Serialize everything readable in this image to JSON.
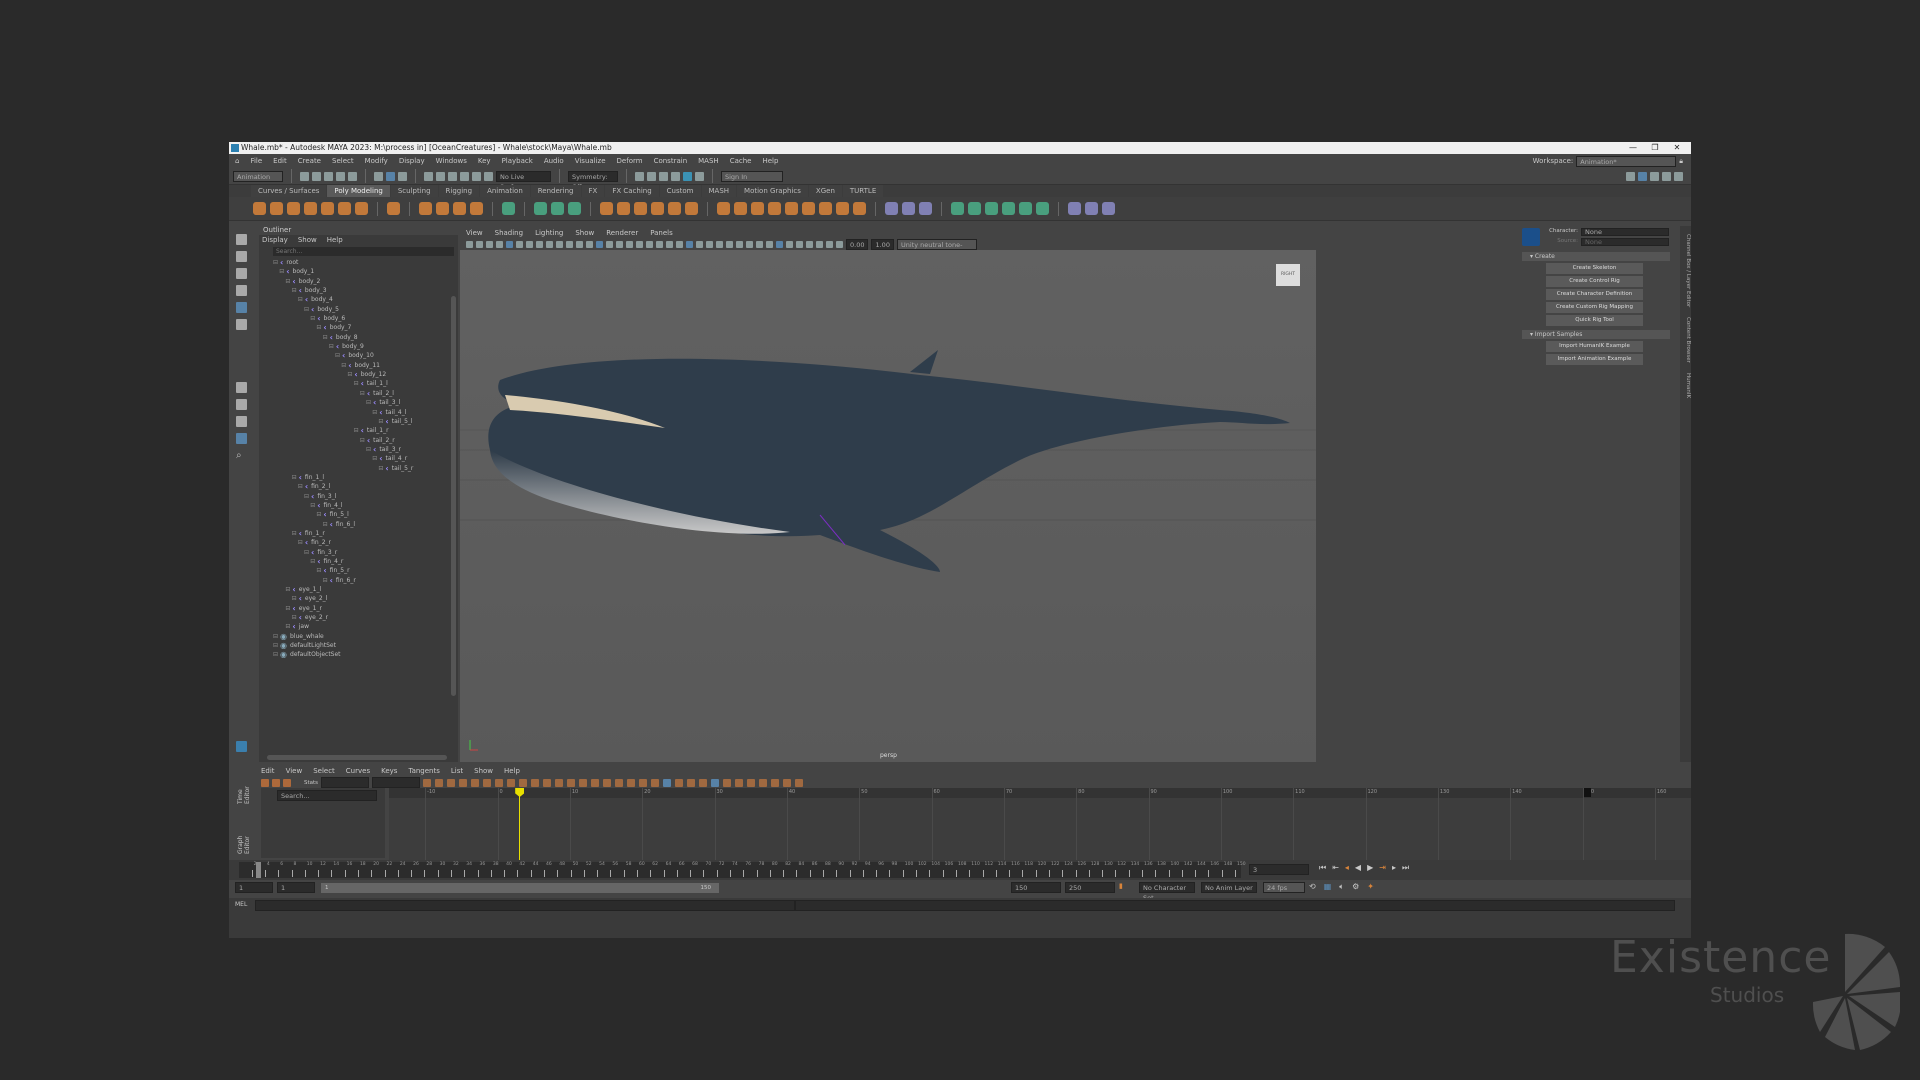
{
  "window": {
    "title": "Whale.mb* - Autodesk MAYA 2023: M:\\process in] [OceanCreatures] - Whale\\stock\\Maya\\Whale.mb",
    "min": "—",
    "max": "❐",
    "close": "✕"
  },
  "menu": [
    "File",
    "Edit",
    "Create",
    "Select",
    "Modify",
    "Display",
    "Windows",
    "Key",
    "Playback",
    "Audio",
    "Visualize",
    "Deform",
    "Constrain",
    "MASH",
    "Cache",
    "Help"
  ],
  "status": {
    "menuset": "Animation",
    "live_surface": "No Live Surface",
    "symmetry": "Symmetry: Off",
    "sign_in": "Sign In",
    "workspace_label": "Workspace:",
    "workspace_value": "Animation*"
  },
  "shelf_tabs": [
    "Curves / Surfaces",
    "Poly Modeling",
    "Sculpting",
    "Rigging",
    "Animation",
    "Rendering",
    "FX",
    "FX Caching",
    "Custom",
    "MASH",
    "Motion Graphics",
    "XGen",
    "TURTLE"
  ],
  "shelf_active": 1,
  "shelf_colors": {
    "poly": "#d9843a",
    "uv": "#4bb08a",
    "rig": "#8c8cc8"
  },
  "outliner": {
    "title": "Outliner",
    "menu": [
      "Display",
      "Show",
      "Help"
    ],
    "search_placeholder": "Search...",
    "items": [
      {
        "label": "root",
        "d": 0
      },
      {
        "label": "body_1",
        "d": 1
      },
      {
        "label": "body_2",
        "d": 2
      },
      {
        "label": "body_3",
        "d": 3
      },
      {
        "label": "body_4",
        "d": 4
      },
      {
        "label": "body_5",
        "d": 5
      },
      {
        "label": "body_6",
        "d": 6
      },
      {
        "label": "body_7",
        "d": 7
      },
      {
        "label": "body_8",
        "d": 8
      },
      {
        "label": "body_9",
        "d": 9
      },
      {
        "label": "body_10",
        "d": 10
      },
      {
        "label": "body_11",
        "d": 11
      },
      {
        "label": "body_12",
        "d": 12
      },
      {
        "label": "tail_1_l",
        "d": 13
      },
      {
        "label": "tail_2_l",
        "d": 14
      },
      {
        "label": "tail_3_l",
        "d": 15
      },
      {
        "label": "tail_4_l",
        "d": 16
      },
      {
        "label": "tail_5_l",
        "d": 17
      },
      {
        "label": "tail_1_r",
        "d": 13
      },
      {
        "label": "tail_2_r",
        "d": 14
      },
      {
        "label": "tail_3_r",
        "d": 15
      },
      {
        "label": "tail_4_r",
        "d": 16
      },
      {
        "label": "tail_5_r",
        "d": 17
      },
      {
        "label": "fin_1_l",
        "d": 3
      },
      {
        "label": "fin_2_l",
        "d": 4
      },
      {
        "label": "fin_3_l",
        "d": 5
      },
      {
        "label": "fin_4_l",
        "d": 6
      },
      {
        "label": "fin_5_l",
        "d": 7
      },
      {
        "label": "fin_6_l",
        "d": 8
      },
      {
        "label": "fin_1_r",
        "d": 3
      },
      {
        "label": "fin_2_r",
        "d": 4
      },
      {
        "label": "fin_3_r",
        "d": 5
      },
      {
        "label": "fin_4_r",
        "d": 6
      },
      {
        "label": "fin_5_r",
        "d": 7
      },
      {
        "label": "fin_6_r",
        "d": 8
      },
      {
        "label": "eye_1_l",
        "d": 2
      },
      {
        "label": "eye_2_l",
        "d": 3
      },
      {
        "label": "eye_1_r",
        "d": 2
      },
      {
        "label": "eye_2_r",
        "d": 3
      },
      {
        "label": "jaw",
        "d": 2
      },
      {
        "label": "blue_whale",
        "d": 0,
        "type": "mesh"
      },
      {
        "label": "defaultLightSet",
        "d": 0,
        "type": "set"
      },
      {
        "label": "defaultObjectSet",
        "d": 0,
        "type": "set"
      }
    ]
  },
  "viewport": {
    "menu": [
      "View",
      "Shading",
      "Lighting",
      "Show",
      "Renderer",
      "Panels"
    ],
    "exposure": "0.00",
    "gamma": "1.00",
    "color_space": "Unity neutral tone-map (sRGB)",
    "camera": "persp",
    "viewcube": "RIGHT"
  },
  "hik": {
    "character_label": "Character:",
    "character_value": "None",
    "source_label": "Source:",
    "source_value": "None",
    "create_header": "Create",
    "create_buttons": [
      "Create Skeleton",
      "Create Control Rig",
      "Create Character Definition",
      "Create Custom Rig Mapping",
      "Quick Rig Tool"
    ],
    "import_header": "Import Samples",
    "import_buttons": [
      "Import HumanIK Example",
      "Import Animation Example"
    ]
  },
  "side_tabs": [
    "Channel Box / Layer Editor",
    "Content Browser",
    "HumanIK"
  ],
  "graph": {
    "tabs": [
      "Graph Editor",
      "Time Editor"
    ],
    "menu": [
      "Edit",
      "View",
      "Select",
      "Curves",
      "Keys",
      "Tangents",
      "List",
      "Show",
      "Help"
    ],
    "stats_label": "Stats",
    "search_placeholder": "Search...",
    "ruler": [
      -10,
      0,
      10,
      20,
      30,
      40,
      50,
      60,
      70,
      80,
      90,
      100,
      110,
      120,
      130,
      140,
      150,
      160
    ],
    "current_frame": 3,
    "range_end_marker": 150,
    "view_min": -15,
    "view_max": 165
  },
  "timeline": {
    "start": 1,
    "end": 150,
    "current": 3,
    "tick_step": 2,
    "current_field": "3"
  },
  "range": {
    "start": "1",
    "anim_start": "1",
    "slider_start": "1",
    "slider_end": "150",
    "anim_end": "150",
    "end": "250",
    "character_set": "No Character Set",
    "anim_layer": "No Anim Layer",
    "fps": "24 fps"
  },
  "cmd": {
    "lang": "MEL"
  },
  "watermark": {
    "line1": "Existence",
    "line2": "Studios"
  }
}
